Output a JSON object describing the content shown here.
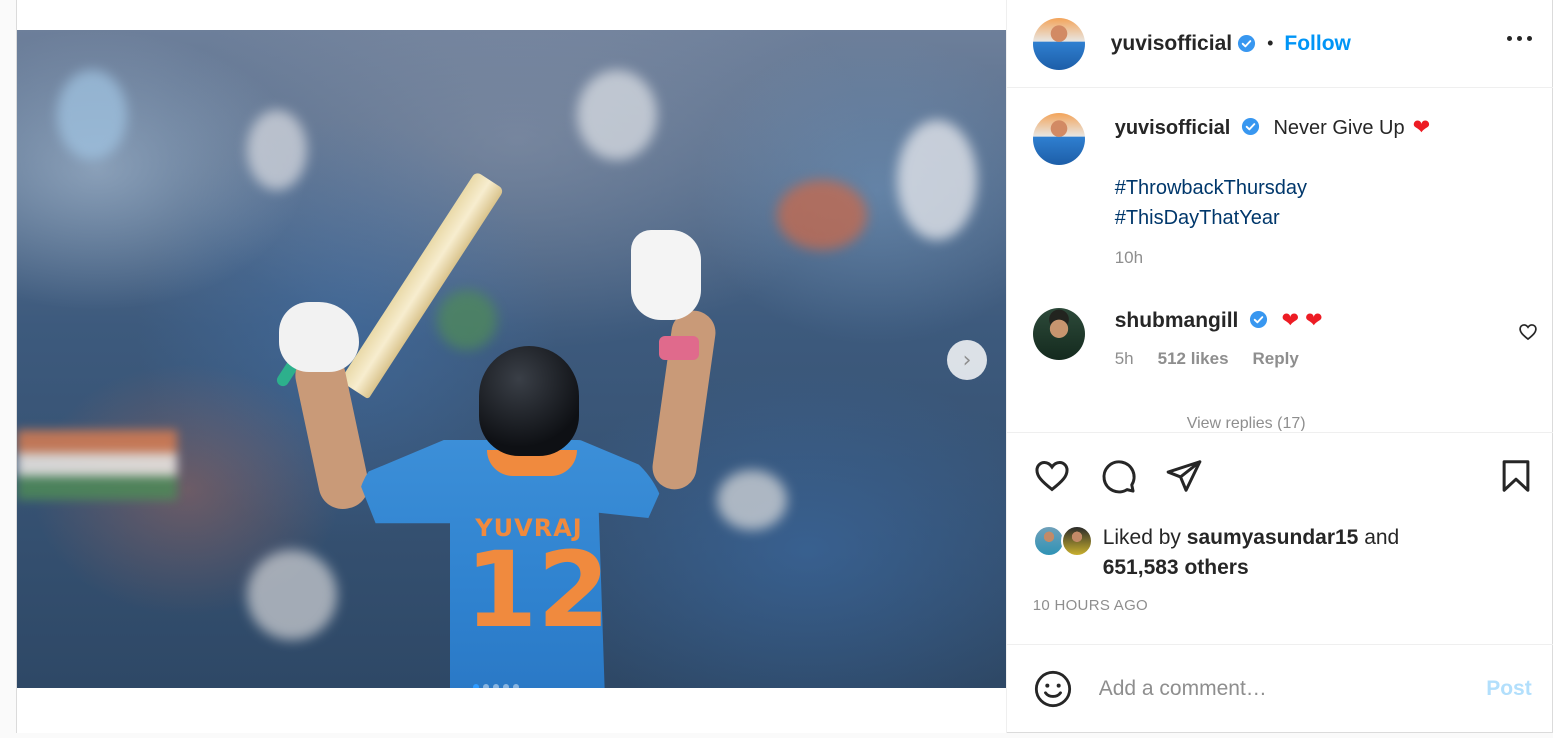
{
  "post": {
    "carousel": {
      "jersey_name": "YUVRAJ",
      "jersey_number": "12",
      "next_icon": "chevron-right-icon",
      "slide_count": 5,
      "active_slide": 1
    },
    "header": {
      "username": "yuvisofficial",
      "separator": "•",
      "follow_label": "Follow"
    },
    "caption": {
      "username": "yuvisofficial",
      "text": "Never Give Up",
      "emoji": "❤",
      "hashtags": [
        "#ThrowbackThursday",
        "#ThisDayThatYear"
      ],
      "time": "10h"
    },
    "comment": {
      "username": "shubmangill",
      "text": "❤ ❤",
      "time": "5h",
      "likes": "512 likes",
      "reply_label": "Reply",
      "view_replies": "View replies (17)"
    },
    "actions": {
      "icons": [
        "heart-icon",
        "comment-icon",
        "share-icon",
        "bookmark-icon"
      ]
    },
    "likes": {
      "prefix": "Liked by",
      "liked_by_user": "saumyasundar15",
      "conjunction": "and",
      "others": "651,583 others"
    },
    "timestamp": "10 HOURS AGO",
    "comment_box": {
      "placeholder": "Add a comment…",
      "post_label": "Post"
    },
    "colors": {
      "accent": "#0095f6",
      "hashtag": "#00376b",
      "verified": "#3897f0",
      "heart": "#ed1c24",
      "post_disabled": "#b2dffc"
    }
  }
}
